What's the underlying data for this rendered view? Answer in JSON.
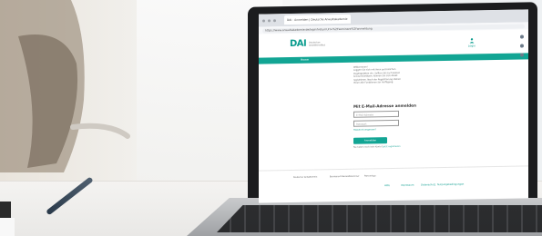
{
  "browser": {
    "tab_title": "DAI - Anmelden | Deutsche Anwaltakademie",
    "url": "https://www.anwaltakademie.de/login?returnUrl=%2Fseminare%2Fanmeldung"
  },
  "site": {
    "logo": "DAI",
    "logo_sub": "Deutsches Anwaltsinstitut",
    "login_badge": "Login",
    "nav_item": "Home"
  },
  "content": {
    "intro_heading": "Willkommen!",
    "intro_text": "Loggen Sie sich mit Ihren persönlichen Zugangsdaten ein. Sollten Sie noch keinen Account besitzen, können Sie sich direkt registrieren. Nach der Registrierung stehen Ihnen alle Funktionen zur Verfügung.",
    "login_title": "Mit E-Mail-Adresse anmelden",
    "email_placeholder": "E-Mail-Adresse",
    "password_placeholder": "Passwort",
    "forgot": "Passwort vergessen?",
    "login_button": "Anmelden",
    "register_prefix": "Sie haben noch kein Konto?",
    "register_link": "Jetzt registrieren"
  },
  "footer": {
    "logos": [
      "Deutscher Anwaltverein",
      "Bundesrechtsanwaltskammer",
      "Partnerlogo"
    ],
    "links": [
      "Hilfe",
      "Impressum",
      "Datenschutz",
      "Nutzungsbedingungen"
    ]
  },
  "colors": {
    "accent": "#12a594",
    "screen_frame": "#1b1c1e"
  }
}
